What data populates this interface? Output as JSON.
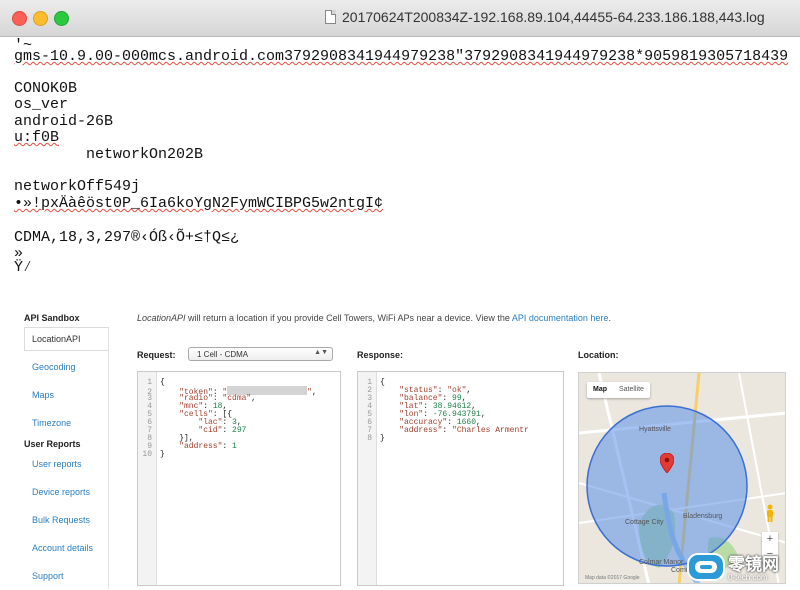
{
  "window": {
    "title": "20170624T200834Z-192.168.89.104,44455-64.233.186.188,443.log"
  },
  "log": {
    "lines": [
      "gms-10.9.00-000mcs.android.com3792908341944979238\"3792908341944979238*9059819305718439",
      "CONOK0B",
      "os_ver",
      "android-26B",
      "u:f0B",
      "        networkOn202B",
      "networkOff549j",
      "•»!pxÄàêöst0P_6Ia6koYgN2FymWCIBPG5w2ntgI¢",
      "CDMA,18,3,297®‹Óß‹Õ+≤†Q≤¿",
      "»",
      "Ÿ⁄"
    ]
  },
  "sandbox": {
    "title": "API Sandbox",
    "active_item": "LocationAPI",
    "nav": [
      "Geocoding",
      "Maps",
      "Timezone"
    ],
    "section": "User Reports",
    "section_items": [
      "User reports",
      "Device reports",
      "Bulk Requests",
      "Account details",
      "Support"
    ],
    "intro_em": "LocationAPI",
    "intro_text": " will return a location if you provide Cell Towers, WiFi APs near a device. View the ",
    "intro_link": "API documentation here",
    "intro_end": ".",
    "request_label": "Request:",
    "request_select": "1 Cell - CDMA",
    "response_label": "Response:",
    "location_label": "Location:"
  },
  "request_code": {
    "token_key": "\"token\"",
    "radio_key": "\"radio\"",
    "radio_val": "\"cdma\"",
    "mnc_key": "\"mnc\"",
    "mnc_val": "18",
    "cells_key": "\"cells\"",
    "lac_key": "\"lac\"",
    "lac_val": "3",
    "cid_key": "\"cid\"",
    "cid_val": "297",
    "address_key": "\"address\"",
    "address_val": "1"
  },
  "response_code": {
    "status_key": "\"status\"",
    "status_val": "\"ok\"",
    "balance_key": "\"balance\"",
    "balance_val": "99",
    "lat_key": "\"lat\"",
    "lat_val": "38.94612",
    "lon_key": "\"lon\"",
    "lon_val": "-76.943791",
    "accuracy_key": "\"accuracy\"",
    "accuracy_val": "1660",
    "address_key": "\"address\"",
    "address_val": "\"Charles Armentr"
  },
  "map": {
    "tab_map": "Map",
    "tab_satellite": "Satellite",
    "place_hyattsville": "Hyattsville",
    "place_cottage_city": "Cottage City",
    "place_bladensburg": "Bladensburg",
    "place_colmar": "Colmar Manor",
    "place_community": "Community",
    "footer": "Map data ©2017 Google",
    "zoom_in": "+",
    "zoom_out": "−",
    "accent_circle": "#5a8fe8",
    "marker_color": "#e53935"
  },
  "watermark": {
    "text": "零镜网",
    "sub": "0-tech.com"
  }
}
